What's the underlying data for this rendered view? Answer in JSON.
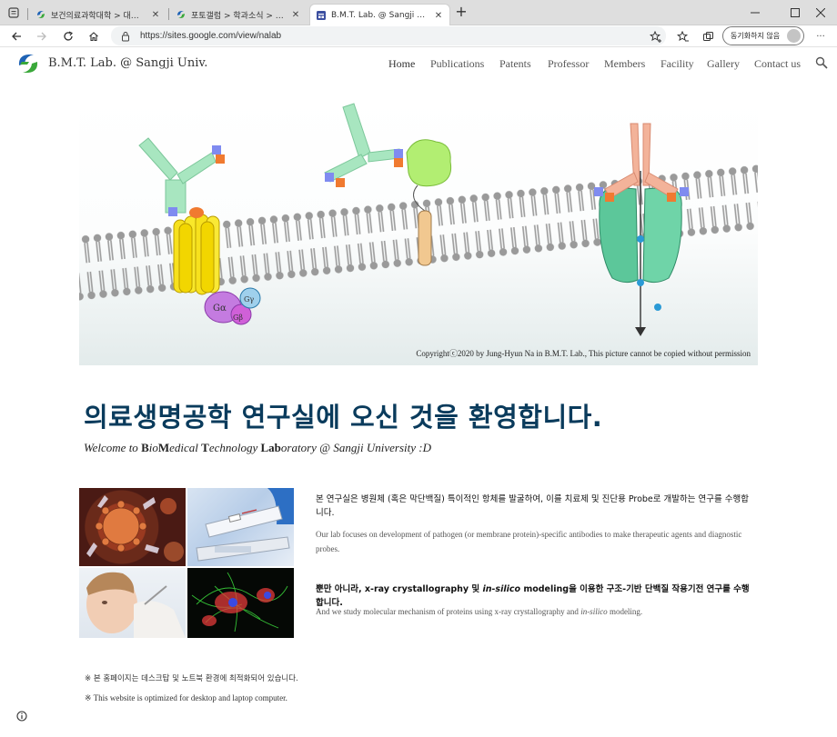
{
  "browser": {
    "tabs": [
      {
        "title": "보건의료과학대학 > 대학 > 상지"
      },
      {
        "title": "포토갤럼 > 학과소식 > 상지대학"
      },
      {
        "title": "B.M.T. Lab. @ Sangji Univ."
      }
    ],
    "new_tab": "+",
    "url": "https://sites.google.com/view/nalab",
    "sync_label": "동기화하지 않음",
    "more": "···"
  },
  "site": {
    "title": "B.M.T. Lab. @ Sangji Univ.",
    "nav": [
      "Home",
      "Publications",
      "Patents",
      "Professor",
      "Members",
      "Facility",
      "Gallery",
      "Contact us"
    ],
    "active_nav": "Home"
  },
  "banner": {
    "copyright": "Copyrightⓒ2020 by Jung-Hyun Na in B.M.T. Lab., This picture cannot be copied without permission",
    "labels": {
      "ga": "Gα",
      "gb": "Gβ",
      "gg": "Gγ"
    }
  },
  "welcome": {
    "headline": "의료생명공학 연구실에 오신 것을 환영합니다.",
    "sub_prefix": "Welcome to ",
    "sub_parts": [
      {
        "b": "B",
        "t": "io"
      },
      {
        "b": "M",
        "t": "edical "
      },
      {
        "b": "T",
        "t": "echnology "
      },
      {
        "b": "Lab",
        "t": "oratory @ Sangji University :D"
      }
    ]
  },
  "content": {
    "ko_1": "본 연구실은 병원체 (혹은 막단백질) 특이적인 항체를 발굴하여, 이를 치료제 및 진단용 Probe로 개발하는 연구를 수행합니다.",
    "en_1": "Our lab focuses on development of pathogen (or membrane protein)-specific antibodies to make therapeutic agents  and diagnostic probes.",
    "ko_2_a": "뿐만 아니라, x-ray crystallography 및 ",
    "ko_2_i": "in-silico",
    "ko_2_b": " modeling을 이용한 구조-기반 단백질 작용기전 연구를 수행합니다.",
    "en_2_a": "And we study molecular mechanism of proteins using x-ray crystallography and ",
    "en_2_i": "in-silico",
    "en_2_b": " modeling."
  },
  "notes": {
    "ko": "※ 본 홈페이지는 데스크탑 및 노트북 환경에 최적화되어 있습니다.",
    "en": "※ This website is optimized for desktop and laptop computer."
  },
  "colors": {
    "brand_blue": "#0a3b5c",
    "logo_blue": "#1f63b5",
    "logo_green": "#3aa83a"
  }
}
